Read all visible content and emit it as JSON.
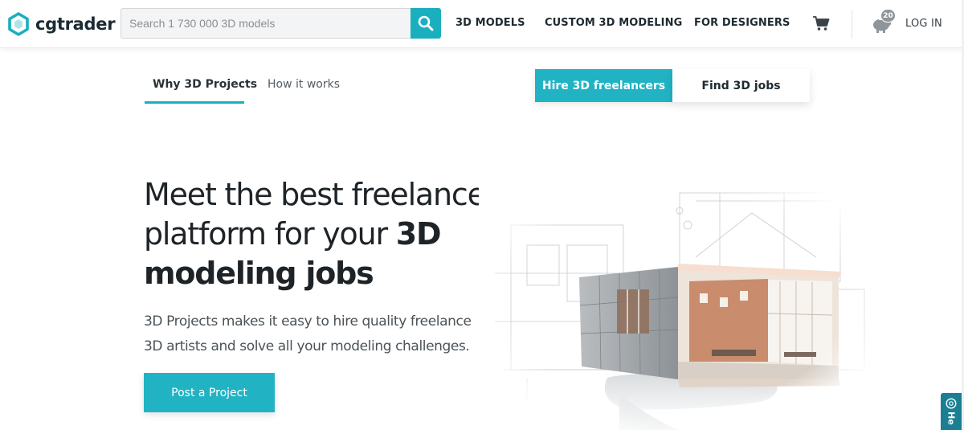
{
  "brand": {
    "name": "cgtrader",
    "accent": "#1aafbf"
  },
  "search": {
    "placeholder": "Search 1 730 000 3D models",
    "value": "",
    "icon": "search-icon"
  },
  "nav": {
    "links": [
      "3D MODELS",
      "CUSTOM 3D MODELING",
      "FOR DESIGNERS"
    ],
    "cart_icon": "cart-icon",
    "notification_icon": "piggy-bank-icon",
    "notification_count": "20",
    "login_label": "LOG IN"
  },
  "subnav": {
    "tabs": [
      "Why 3D Projects",
      "How it works"
    ],
    "active_tab": "Why 3D Projects",
    "toggle": [
      "Hire 3D freelancers",
      "Find 3D jobs"
    ],
    "active_toggle": "Hire 3D freelancers"
  },
  "hero": {
    "title_regular": "Meet the best freelance platform for your ",
    "title_bold": "3D modeling jobs",
    "description": "3D Projects makes it easy to hire quality freelance 3D artists and solve all your modeling challenges.",
    "cta_label": "Post a Project"
  },
  "help": {
    "label": "He",
    "icon": "help-circle-icon"
  }
}
